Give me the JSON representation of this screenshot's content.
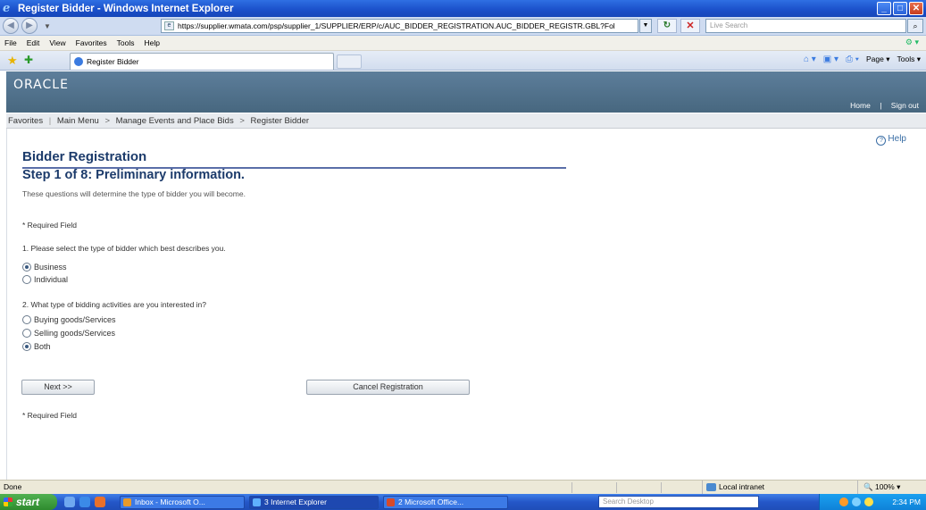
{
  "window": {
    "title": "Register Bidder - Windows Internet Explorer",
    "min_label": "_",
    "max_label": "□",
    "close_label": "✕"
  },
  "address": {
    "url": "https://supplier.wmata.com/psp/supplier_1/SUPPLIER/ERP/c/AUC_BIDDER_REGISTRATION.AUC_BIDDER_REGISTR.GBL?Fol",
    "search_placeholder": "Live Search"
  },
  "menu": [
    "File",
    "Edit",
    "View",
    "Favorites",
    "Tools",
    "Help"
  ],
  "tab": {
    "label": "Register Bidder"
  },
  "commandbar": {
    "page_label": "Page",
    "tools_label": "Tools"
  },
  "header": {
    "logo": "ORACLE",
    "home_link": "Home",
    "signout_link": "Sign out"
  },
  "breadcrumb": {
    "favorites": "Favorites",
    "main_menu": "Main Menu",
    "manage_events": "Manage Events and Place Bids",
    "current": "Register Bidder"
  },
  "content": {
    "help_link": "Help",
    "page_title": "Bidder Registration",
    "step_title": "Step 1 of 8: Preliminary information.",
    "intro": "These questions will determine the type of bidder you will become.",
    "required_note_top": "* Required Field",
    "question1": "1. Please select the type of bidder which best describes you.",
    "q1_options": [
      {
        "label": "Business",
        "checked": true
      },
      {
        "label": "Individual",
        "checked": false
      }
    ],
    "question2": "2. What type of bidding activities are you interested in?",
    "q2_options": [
      {
        "label": "Buying goods/Services",
        "checked": false
      },
      {
        "label": "Selling goods/Services",
        "checked": false
      },
      {
        "label": "Both",
        "checked": true
      }
    ],
    "next_button": "Next >>",
    "cancel_button": "Cancel Registration",
    "required_note_bottom": "* Required Field"
  },
  "status": {
    "text": "Done",
    "zone": "Local intranet",
    "zoom": "100%"
  },
  "taskbar": {
    "start": "start",
    "tasks": [
      {
        "label": "Inbox - Microsoft O...",
        "color": "#e89a2a"
      },
      {
        "label": "3 Internet Explorer",
        "color": "#5fb0ff"
      },
      {
        "label": "2 Microsoft Office...",
        "color": "#d84a2a"
      }
    ],
    "search_placeholder": "Search Desktop",
    "clock": "2:34 PM"
  }
}
